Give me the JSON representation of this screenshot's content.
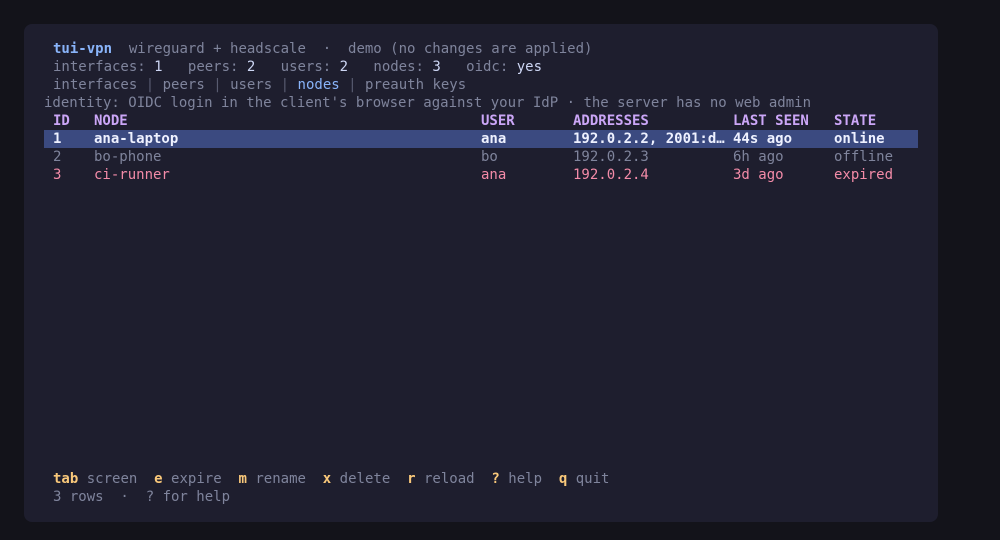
{
  "header": {
    "app_name": "tui-vpn",
    "subtitle": "wireguard + headscale  ·  demo (no changes are applied)"
  },
  "stats": [
    {
      "label": "interfaces:",
      "value": "1"
    },
    {
      "label": "peers:",
      "value": "2"
    },
    {
      "label": "users:",
      "value": "2"
    },
    {
      "label": "nodes:",
      "value": "3"
    },
    {
      "label": "oidc:",
      "value": "yes"
    }
  ],
  "tabs": [
    {
      "label": "interfaces",
      "active": false
    },
    {
      "label": "peers",
      "active": false
    },
    {
      "label": "users",
      "active": false
    },
    {
      "label": "nodes",
      "active": true
    },
    {
      "label": "preauth keys",
      "active": false
    }
  ],
  "tab_separator": "|",
  "identity_note": "identity: OIDC login in the client's browser against your IdP · the server has no web admin",
  "table": {
    "columns": [
      "ID",
      "NODE",
      "USER",
      "ADDRESSES",
      "LAST SEEN",
      "STATE"
    ],
    "rows": [
      {
        "id": "1",
        "node": "ana-laptop",
        "user": "ana",
        "addresses": "192.0.2.2, 2001:d…",
        "last_seen": "44s ago",
        "state": "online",
        "status": "selected"
      },
      {
        "id": "2",
        "node": "bo-phone",
        "user": "bo",
        "addresses": "192.0.2.3",
        "last_seen": "6h ago",
        "state": "offline",
        "status": "offline"
      },
      {
        "id": "3",
        "node": "ci-runner",
        "user": "ana",
        "addresses": "192.0.2.4",
        "last_seen": "3d ago",
        "state": "expired",
        "status": "expired"
      }
    ]
  },
  "keybindings": [
    {
      "key": "tab",
      "label": "screen"
    },
    {
      "key": "e",
      "label": "expire"
    },
    {
      "key": "m",
      "label": "rename"
    },
    {
      "key": "x",
      "label": "delete"
    },
    {
      "key": "r",
      "label": "reload"
    },
    {
      "key": "?",
      "label": "help"
    },
    {
      "key": "q",
      "label": "quit"
    }
  ],
  "status_line": "3 rows  ·  ? for help",
  "colors": {
    "background": "#1e1e2e",
    "accent": "#89b4fa",
    "header": "#cba6f7",
    "selected_row": "#3b4a80",
    "expired": "#f38ba8",
    "key": "#f9c87a"
  }
}
